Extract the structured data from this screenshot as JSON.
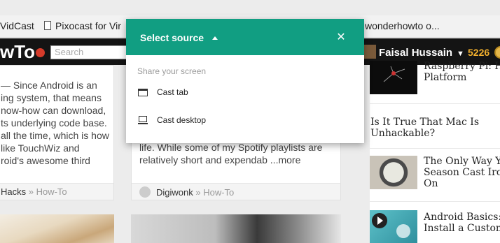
{
  "bookmarks": [
    {
      "label": "VidCast"
    },
    {
      "label": "Pixocast for Vir"
    },
    {
      "label": "wonderhowto o..."
    }
  ],
  "site": {
    "logo_text": "wTo",
    "search_placeholder": "Search",
    "user_name": "Faisal Hussain",
    "points": "5226"
  },
  "cards": [
    {
      "lines": [
        "— Since Android is an",
        "ing system, that means",
        "now-how can download,",
        "ts underlying code base.",
        "all the time, which is how",
        "like TouchWiz and",
        "roid's awesome third"
      ],
      "author": "Hacks",
      "section": "» How-To"
    },
    {
      "lines": [
        "life. While some of my Spotify playlists are",
        "relatively short and expendab ...more"
      ],
      "author": "Digiwonk",
      "section": "» How-To"
    }
  ],
  "sidebar": [
    {
      "title_lines": [
        "Raspberry Pi: Ha",
        "Platform"
      ]
    },
    {
      "title_lines": [
        "Is It True That Mac Is",
        "Unhackable?"
      ]
    },
    {
      "title_lines": [
        "The Only Way Y",
        "Season Cast Iron",
        "On"
      ]
    },
    {
      "title_lines": [
        "Android Basics:",
        "Install a Custom"
      ]
    }
  ],
  "dialog": {
    "title": "Select source",
    "close_symbol": "✕",
    "subtitle": "Share your screen",
    "options": [
      {
        "label": "Cast tab",
        "icon": "tab-icon"
      },
      {
        "label": "Cast desktop",
        "icon": "laptop-icon"
      }
    ]
  }
}
